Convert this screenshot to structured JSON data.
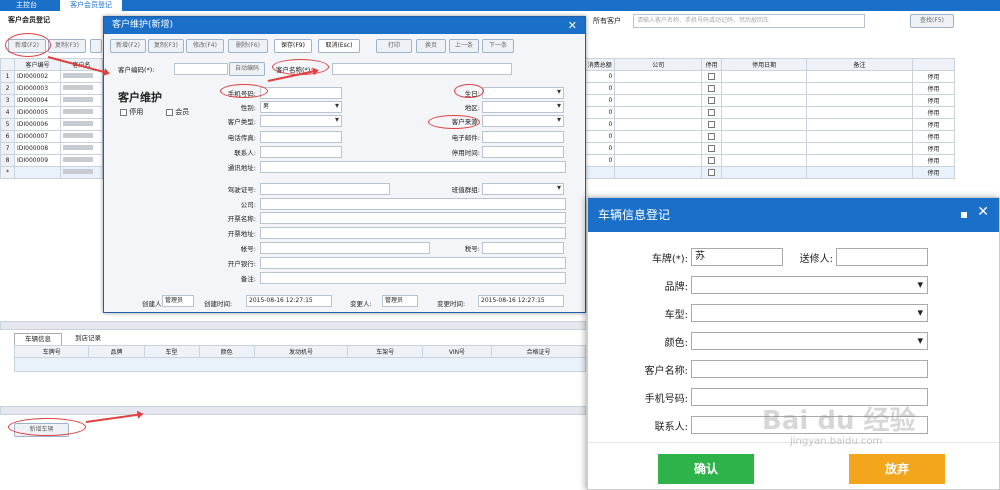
{
  "tabs": [
    {
      "label": "主控台"
    },
    {
      "label": "客户会员登记"
    }
  ],
  "page_title": "客户会员登记",
  "toolbar": {
    "new": "新增(F2)",
    "copy": "复制(F3)",
    "filter_label": "所有客户",
    "search_placeholder": "请输入客户名称、手机号码或动记码，然后敲回车",
    "search_btn": "查找(F5)"
  },
  "table": {
    "headers_left": [
      "客户编号",
      "客户名"
    ],
    "headers_right": [
      "消费总额",
      "公司",
      "停用",
      "停用日期",
      "备注"
    ],
    "rows": [
      {
        "n": "1",
        "id": "IDI000002",
        "total": "0",
        "btn": "停用"
      },
      {
        "n": "2",
        "id": "IDI000003",
        "total": "0",
        "btn": "停用"
      },
      {
        "n": "3",
        "id": "IDI000004",
        "total": "0",
        "btn": "停用"
      },
      {
        "n": "4",
        "id": "IDI000005",
        "total": "0",
        "btn": "停用"
      },
      {
        "n": "5",
        "id": "IDI000006",
        "total": "0",
        "btn": "停用"
      },
      {
        "n": "6",
        "id": "IDI000007",
        "total": "0",
        "btn": "停用"
      },
      {
        "n": "7",
        "id": "IDI000008",
        "total": "0",
        "btn": "停用"
      },
      {
        "n": "8",
        "id": "IDI000009",
        "total": "0",
        "btn": "停用"
      },
      {
        "n": "*",
        "id": "",
        "total": "",
        "btn": "停用"
      }
    ]
  },
  "bottom_tabs": [
    "车辆信息",
    "到店记录"
  ],
  "vehicle_grid_headers": [
    "车牌号",
    "品牌",
    "车型",
    "颜色",
    "发动机号",
    "车架号",
    "VIN号",
    "合格证号"
  ],
  "add_vehicle_btn": "新增车辆",
  "dialog": {
    "title": "客户维护(新增)",
    "buttons": [
      "新增(F2)",
      "复制(F3)",
      "修改(F4)",
      "删除(F6)",
      "保存(F9)",
      "取消(Esc)",
      "打印",
      "换页",
      "上一条",
      "下一条"
    ],
    "code_label": "客户编码(*):",
    "auto_btn": "自动编码",
    "name_label": "客户名称(*):",
    "section_title": "客户维护",
    "chk_disabled": "停用",
    "chk_member": "会员",
    "fields_left": [
      "手机号码:",
      "性别:",
      "客户类型:",
      "电话传真:",
      "联系人:",
      "通讯地址:",
      "驾驶证号:",
      "公司:",
      "开票名称:",
      "开票地址:",
      "帐号:",
      "开户银行:",
      "备注:"
    ],
    "gender_value": "男",
    "fields_right": [
      "生日:",
      "地区:",
      "客户来源:",
      "电子邮件:",
      "停用时间:",
      "班值群组:",
      "税号:"
    ],
    "footer": {
      "creator_label": "创建人:",
      "creator": "管理员",
      "ctime_label": "创建时间:",
      "ctime": "2015-08-16 12:27:15",
      "modifier_label": "变更人:",
      "modifier": "管理员",
      "mtime_label": "变更时间:",
      "mtime": "2015-08-16 12:27:15"
    }
  },
  "vehicle_dialog": {
    "title": "车辆信息登记",
    "plate_label": "车牌(*):",
    "plate_value": "苏",
    "repair_label": "送修人:",
    "brand_label": "品牌:",
    "model_label": "车型:",
    "color_label": "颜色:",
    "cust_label": "客户名称:",
    "phone_label": "手机号码:",
    "contact_label": "联系人:",
    "confirm": "确认",
    "cancel": "放弃"
  },
  "watermark": {
    "brand": "Bai du 经验",
    "url": "jingyan.baidu.com"
  },
  "colors": {
    "accent": "#1a6fc9",
    "confirm": "#2db34a",
    "cancel": "#f3a51b",
    "annotation": "#e04040"
  }
}
